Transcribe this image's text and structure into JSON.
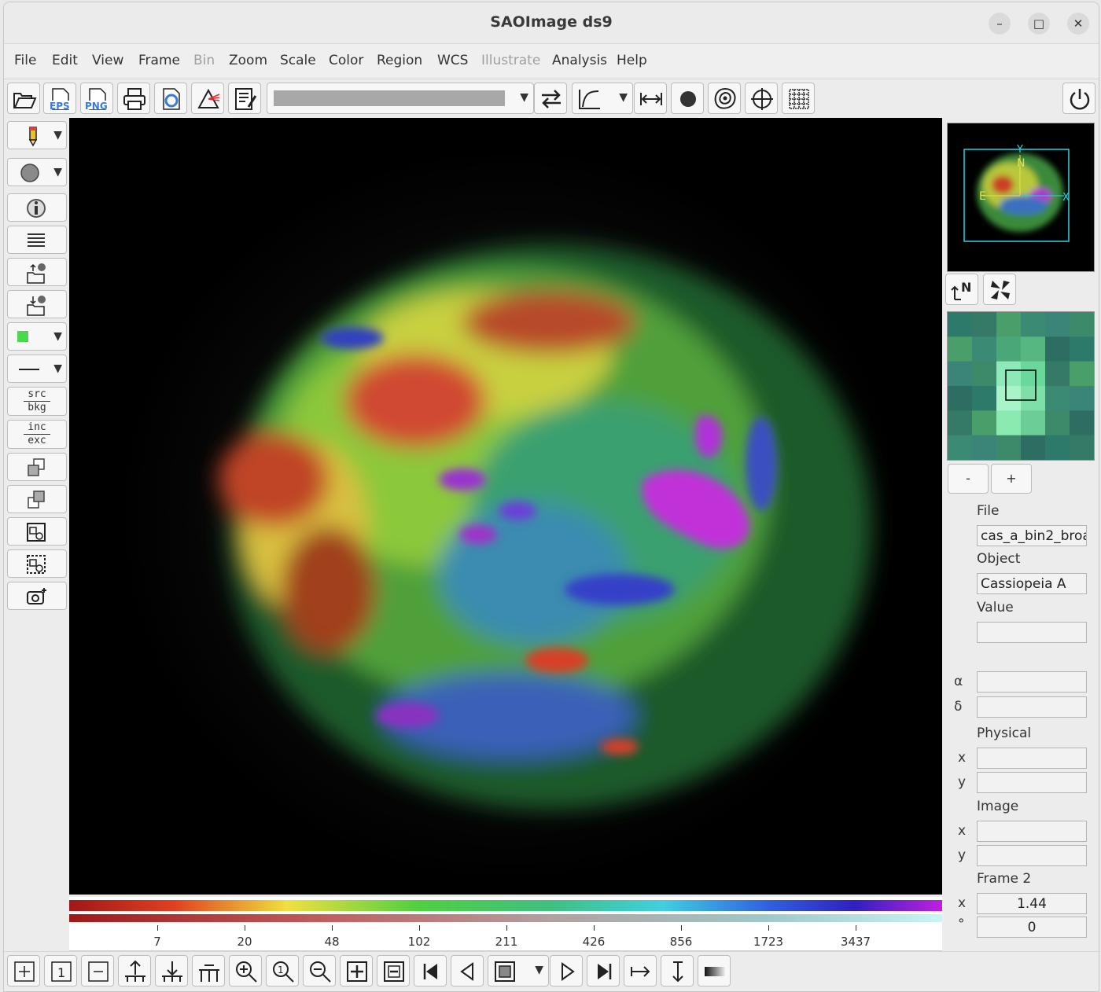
{
  "window": {
    "title": "SAOImage ds9",
    "minimize": "–",
    "maximize": "□",
    "close": "✕"
  },
  "menubar": {
    "items": [
      {
        "label": "File",
        "enabled": true
      },
      {
        "label": "Edit",
        "enabled": true
      },
      {
        "label": "View",
        "enabled": true
      },
      {
        "label": "Frame",
        "enabled": true
      },
      {
        "label": "Bin",
        "enabled": false
      },
      {
        "label": "Zoom",
        "enabled": true
      },
      {
        "label": "Scale",
        "enabled": true
      },
      {
        "label": "Color",
        "enabled": true
      },
      {
        "label": "Region",
        "enabled": true
      },
      {
        "label": "WCS",
        "enabled": true
      },
      {
        "label": "Illustrate",
        "enabled": false
      },
      {
        "label": "Analysis",
        "enabled": true
      },
      {
        "label": "Help",
        "enabled": true
      }
    ]
  },
  "toolbar": {
    "eps_label": "EPS",
    "png_label": "PNG",
    "dropdown_arrow": "▼"
  },
  "leftbar": {
    "src": "src",
    "bkg": "bkg",
    "inc": "inc",
    "exc": "exc",
    "color_swatch": "#4cd84c",
    "dropdown_arrow": "▼"
  },
  "colorbar": {
    "ticks": [
      "7",
      "20",
      "48",
      "102",
      "211",
      "426",
      "856",
      "1723",
      "3437"
    ]
  },
  "panner": {
    "label_n": "N",
    "label_e": "E",
    "label_x": "X",
    "label_y": "Y"
  },
  "magnifier": {
    "minus": "-",
    "plus": "+"
  },
  "info": {
    "file_label": "File",
    "file_value": "cas_a_bin2_broa",
    "object_label": "Object",
    "object_value": "Cassiopeia A",
    "value_label": "Value",
    "value_value": "",
    "alpha_label": "α",
    "alpha_value": "",
    "delta_label": "δ",
    "delta_value": "",
    "physical_label": "Physical",
    "phys_x_label": "x",
    "phys_x_value": "",
    "phys_y_label": "y",
    "phys_y_value": "",
    "image_label": "Image",
    "img_x_label": "x",
    "img_x_value": "",
    "img_y_label": "y",
    "img_y_value": "",
    "frame_label": "Frame 2",
    "zoom_label": "x",
    "zoom_value": "1.44",
    "angle_label": "°",
    "angle_value": "0"
  },
  "colors": {
    "accent_cyan": "#4fd8e8",
    "panner_cyan": "#2ed0e0"
  }
}
